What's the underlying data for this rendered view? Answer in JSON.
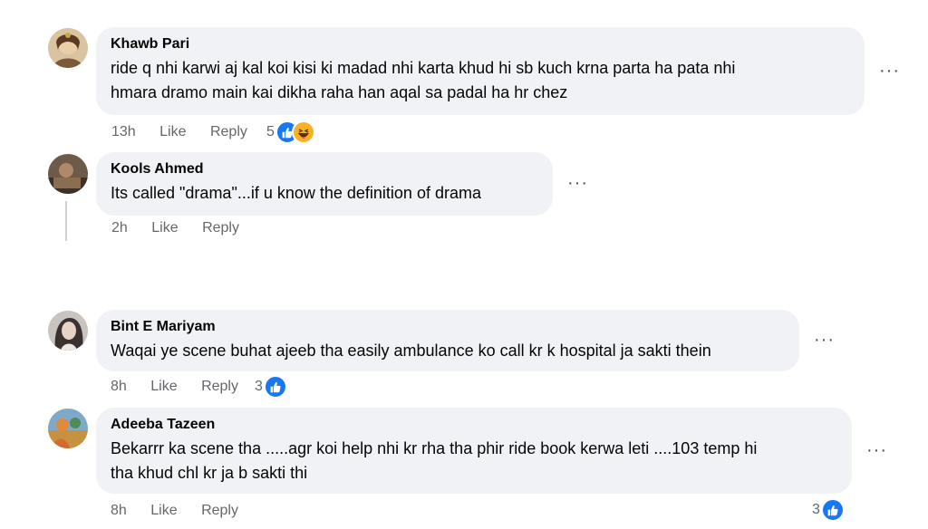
{
  "comments": [
    {
      "author": "Khawb Pari",
      "lines": [
        "ride q nhi karwi aj kal koi kisi ki madad nhi karta khud hi sb kuch krna parta ha pata nhi",
        "hmara dramo main kai dikha raha han aqal sa padal ha hr chez"
      ],
      "time": "13h",
      "like_label": "Like",
      "reply_label": "Reply",
      "reaction_count": "5",
      "reaction_icons": [
        "like-icon",
        "haha-icon"
      ]
    },
    {
      "author": "Kools Ahmed",
      "lines": [
        "Its called \"drama\"...if u know the definition of drama"
      ],
      "time": "2h",
      "like_label": "Like",
      "reply_label": "Reply"
    },
    {
      "author": "Bint E Mariyam",
      "lines": [
        "Waqai ye scene buhat ajeeb tha easily ambulance ko call kr k hospital ja sakti thein"
      ],
      "time": "8h",
      "like_label": "Like",
      "reply_label": "Reply",
      "reaction_count": "3",
      "reaction_icons": [
        "like-icon"
      ]
    },
    {
      "author": "Adeeba Tazeen",
      "lines": [
        "Bekarrr ka scene tha .....agr koi help nhi kr rha tha phir ride book kerwa leti ....103 temp hi",
        "tha khud chl kr ja b sakti thi"
      ],
      "time": "8h",
      "like_label": "Like",
      "reply_label": "Reply",
      "reaction_count": "3",
      "reaction_icons": [
        "like-icon"
      ]
    }
  ],
  "colors": {
    "bubble": "#f0f2f5",
    "meta_text": "#65676b",
    "like_blue": "#1877f2",
    "haha_yellow": "#f7b125"
  },
  "more_icon": "more-options-icon"
}
